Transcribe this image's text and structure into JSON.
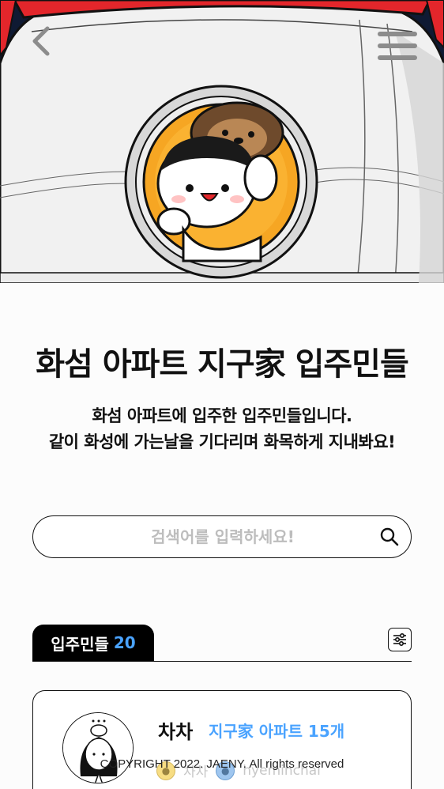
{
  "header": {
    "back_icon": "chevron-left-icon",
    "menu_icon": "hamburger-menu-icon"
  },
  "title": "화섬 아파트 지구家 입주민들",
  "description": {
    "line1": "화섬 아파트에 입주한 입주민들입니다.",
    "line2": "같이 화성에 가는날을 기다리며 화목하게 지내봐요!"
  },
  "search": {
    "placeholder": "검색어를 입력하세요!",
    "value": "",
    "icon": "search-icon"
  },
  "residents": {
    "tab_label": "입주민들",
    "count": "20",
    "filter_icon": "sliders-filter-icon"
  },
  "cards": [
    {
      "name": "차차",
      "apartments": "지구家 아파트 15개",
      "meta1": "차차",
      "meta2": "hyeminchal"
    }
  ],
  "footer": {
    "copyright": "COPYRIGHT 2022. JAENY. All rights reserved"
  },
  "colors": {
    "accent_blue": "#4aa3ff",
    "hero_bg": "#0f1a33",
    "rocket_red": "#e3262b",
    "porthole_orange": "#f6a623"
  }
}
